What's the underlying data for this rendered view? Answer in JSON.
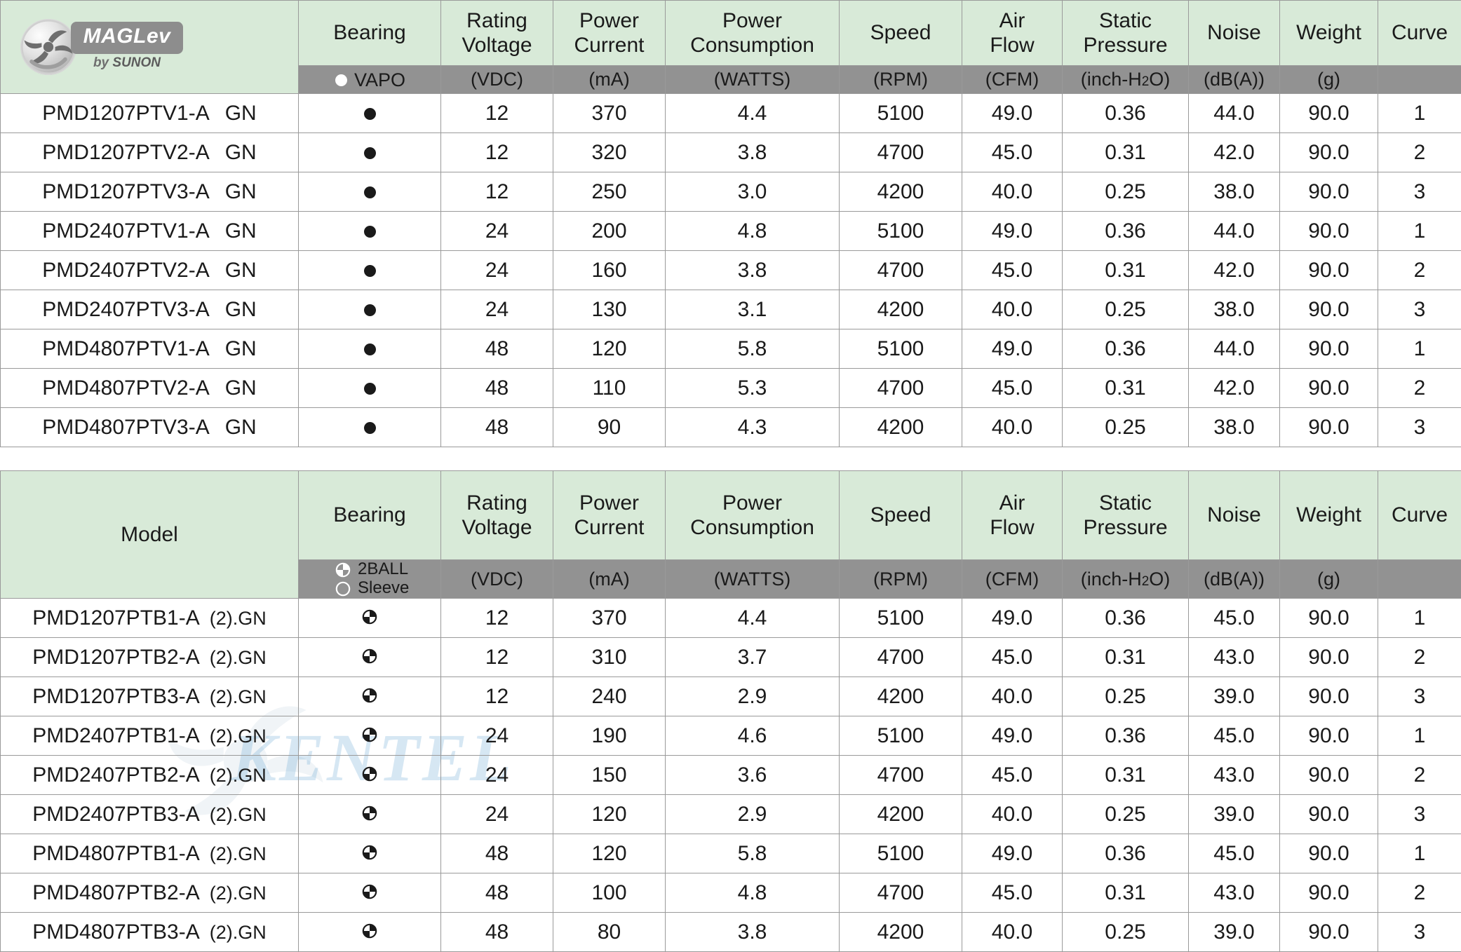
{
  "logo": {
    "badge_icon": "maglev-fan-badge-icon",
    "name": "MAGLev",
    "tagline_prefix": "by ",
    "tagline_brand": "SUNON"
  },
  "watermark": {
    "text": "KENTEL",
    "fan_icon": "fan-watermark-icon"
  },
  "columns": {
    "model": "Model",
    "bearing": "Bearing",
    "rating_voltage": "Rating\nVoltage",
    "rating_voltage_l1": "Rating",
    "rating_voltage_l2": "Voltage",
    "power_current_l1": "Power",
    "power_current_l2": "Current",
    "power_consumption_l1": "Power",
    "power_consumption_l2": "Consumption",
    "speed": "Speed",
    "air_flow_l1": "Air",
    "air_flow_l2": "Flow",
    "static_pressure_l1": "Static",
    "static_pressure_l2": "Pressure",
    "noise": "Noise",
    "weight": "Weight",
    "curve": "Curve"
  },
  "units": {
    "voltage": "(VDC)",
    "current": "(mA)",
    "consumption": "(WATTS)",
    "speed": "(RPM)",
    "air_flow": "(CFM)",
    "static_pressure_main": "(inch-H",
    "static_pressure_sub": "2",
    "static_pressure_tail": "O)",
    "noise": "(dB(A))",
    "weight": "(g)",
    "curve": ""
  },
  "bearing_legend": {
    "vapo": "VAPO",
    "two_ball": "2BALL",
    "sleeve": "Sleeve"
  },
  "colors": {
    "header_green": "#d8ead8",
    "unit_gray": "#929292",
    "border": "#9a9a9a",
    "text": "#1a1a1a",
    "watermark_blue": "#78afd7"
  },
  "table1": {
    "bearing_type": "vapo",
    "rows": [
      {
        "model": "PMD1207PTV1-A",
        "suffix": "GN",
        "bearing": "vapo",
        "voltage": "12",
        "current": "370",
        "consumption": "4.4",
        "speed": "5100",
        "air_flow": "49.0",
        "static_pressure": "0.36",
        "noise": "44.0",
        "weight": "90.0",
        "curve": "1"
      },
      {
        "model": "PMD1207PTV2-A",
        "suffix": "GN",
        "bearing": "vapo",
        "voltage": "12",
        "current": "320",
        "consumption": "3.8",
        "speed": "4700",
        "air_flow": "45.0",
        "static_pressure": "0.31",
        "noise": "42.0",
        "weight": "90.0",
        "curve": "2"
      },
      {
        "model": "PMD1207PTV3-A",
        "suffix": "GN",
        "bearing": "vapo",
        "voltage": "12",
        "current": "250",
        "consumption": "3.0",
        "speed": "4200",
        "air_flow": "40.0",
        "static_pressure": "0.25",
        "noise": "38.0",
        "weight": "90.0",
        "curve": "3"
      },
      {
        "model": "PMD2407PTV1-A",
        "suffix": "GN",
        "bearing": "vapo",
        "voltage": "24",
        "current": "200",
        "consumption": "4.8",
        "speed": "5100",
        "air_flow": "49.0",
        "static_pressure": "0.36",
        "noise": "44.0",
        "weight": "90.0",
        "curve": "1"
      },
      {
        "model": "PMD2407PTV2-A",
        "suffix": "GN",
        "bearing": "vapo",
        "voltage": "24",
        "current": "160",
        "consumption": "3.8",
        "speed": "4700",
        "air_flow": "45.0",
        "static_pressure": "0.31",
        "noise": "42.0",
        "weight": "90.0",
        "curve": "2"
      },
      {
        "model": "PMD2407PTV3-A",
        "suffix": "GN",
        "bearing": "vapo",
        "voltage": "24",
        "current": "130",
        "consumption": "3.1",
        "speed": "4200",
        "air_flow": "40.0",
        "static_pressure": "0.25",
        "noise": "38.0",
        "weight": "90.0",
        "curve": "3"
      },
      {
        "model": "PMD4807PTV1-A",
        "suffix": "GN",
        "bearing": "vapo",
        "voltage": "48",
        "current": "120",
        "consumption": "5.8",
        "speed": "5100",
        "air_flow": "49.0",
        "static_pressure": "0.36",
        "noise": "44.0",
        "weight": "90.0",
        "curve": "1"
      },
      {
        "model": "PMD4807PTV2-A",
        "suffix": "GN",
        "bearing": "vapo",
        "voltage": "48",
        "current": "110",
        "consumption": "5.3",
        "speed": "4700",
        "air_flow": "45.0",
        "static_pressure": "0.31",
        "noise": "42.0",
        "weight": "90.0",
        "curve": "2"
      },
      {
        "model": "PMD4807PTV3-A",
        "suffix": "GN",
        "bearing": "vapo",
        "voltage": "48",
        "current": "90",
        "consumption": "4.3",
        "speed": "4200",
        "air_flow": "40.0",
        "static_pressure": "0.25",
        "noise": "38.0",
        "weight": "90.0",
        "curve": "3"
      }
    ]
  },
  "table2": {
    "bearing_type": "ball",
    "rows": [
      {
        "model": "PMD1207PTB1-A",
        "suffix": "(2).GN",
        "bearing": "ball",
        "voltage": "12",
        "current": "370",
        "consumption": "4.4",
        "speed": "5100",
        "air_flow": "49.0",
        "static_pressure": "0.36",
        "noise": "45.0",
        "weight": "90.0",
        "curve": "1"
      },
      {
        "model": "PMD1207PTB2-A",
        "suffix": "(2).GN",
        "bearing": "ball",
        "voltage": "12",
        "current": "310",
        "consumption": "3.7",
        "speed": "4700",
        "air_flow": "45.0",
        "static_pressure": "0.31",
        "noise": "43.0",
        "weight": "90.0",
        "curve": "2"
      },
      {
        "model": "PMD1207PTB3-A",
        "suffix": "(2).GN",
        "bearing": "ball",
        "voltage": "12",
        "current": "240",
        "consumption": "2.9",
        "speed": "4200",
        "air_flow": "40.0",
        "static_pressure": "0.25",
        "noise": "39.0",
        "weight": "90.0",
        "curve": "3"
      },
      {
        "model": "PMD2407PTB1-A",
        "suffix": "(2).GN",
        "bearing": "ball",
        "voltage": "24",
        "current": "190",
        "consumption": "4.6",
        "speed": "5100",
        "air_flow": "49.0",
        "static_pressure": "0.36",
        "noise": "45.0",
        "weight": "90.0",
        "curve": "1"
      },
      {
        "model": "PMD2407PTB2-A",
        "suffix": "(2).GN",
        "bearing": "ball",
        "voltage": "24",
        "current": "150",
        "consumption": "3.6",
        "speed": "4700",
        "air_flow": "45.0",
        "static_pressure": "0.31",
        "noise": "43.0",
        "weight": "90.0",
        "curve": "2"
      },
      {
        "model": "PMD2407PTB3-A",
        "suffix": "(2).GN",
        "bearing": "ball",
        "voltage": "24",
        "current": "120",
        "consumption": "2.9",
        "speed": "4200",
        "air_flow": "40.0",
        "static_pressure": "0.25",
        "noise": "39.0",
        "weight": "90.0",
        "curve": "3"
      },
      {
        "model": "PMD4807PTB1-A",
        "suffix": "(2).GN",
        "bearing": "ball",
        "voltage": "48",
        "current": "120",
        "consumption": "5.8",
        "speed": "5100",
        "air_flow": "49.0",
        "static_pressure": "0.36",
        "noise": "45.0",
        "weight": "90.0",
        "curve": "1"
      },
      {
        "model": "PMD4807PTB2-A",
        "suffix": "(2).GN",
        "bearing": "ball",
        "voltage": "48",
        "current": "100",
        "consumption": "4.8",
        "speed": "4700",
        "air_flow": "45.0",
        "static_pressure": "0.31",
        "noise": "43.0",
        "weight": "90.0",
        "curve": "2"
      },
      {
        "model": "PMD4807PTB3-A",
        "suffix": "(2).GN",
        "bearing": "ball",
        "voltage": "48",
        "current": "80",
        "consumption": "3.8",
        "speed": "4200",
        "air_flow": "40.0",
        "static_pressure": "0.25",
        "noise": "39.0",
        "weight": "90.0",
        "curve": "3"
      }
    ]
  }
}
